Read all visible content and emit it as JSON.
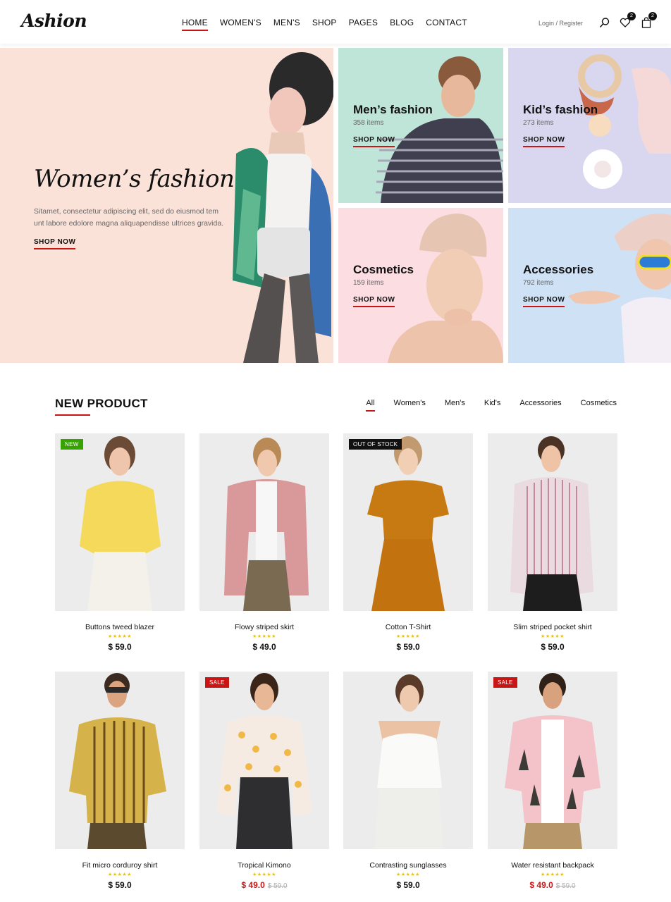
{
  "brand": {
    "logo": "Ashion"
  },
  "nav": {
    "items": [
      "HOME",
      "WOMEN'S",
      "MEN'S",
      "SHOP",
      "PAGES",
      "BLOG",
      "CONTACT"
    ],
    "active": "HOME"
  },
  "header": {
    "login": "Login / Register",
    "wishlist_count": "2",
    "cart_count": "2",
    "icons": [
      "search-icon",
      "heart-icon",
      "bag-icon"
    ]
  },
  "banner": {
    "women": {
      "title": "Women’s fashion",
      "description": "Sitamet, consectetur adipiscing elit, sed do eiusmod tem...id-unt labore edolore magna aliquapendisse ultrices gravida.",
      "desc_line1": "Sitamet, consectetur adipiscing elit, sed do eiusmod tem",
      "desc_line2": "unt labore edolore magna aliquapendisse ultrices gravida.",
      "cta": "SHOP NOW"
    },
    "categories": [
      {
        "title": "Men’s fashion",
        "count": "358 items",
        "cta": "SHOP NOW"
      },
      {
        "title": "Kid’s fashion",
        "count": "273 items",
        "cta": "SHOP NOW"
      },
      {
        "title": "Cosmetics",
        "count": "159 items",
        "cta": "SHOP NOW"
      },
      {
        "title": "Accessories",
        "count": "792 items",
        "cta": "SHOP NOW"
      }
    ]
  },
  "products_section": {
    "title": "NEW PRODUCT",
    "filters": [
      "All",
      "Women's",
      "Men's",
      "Kid's",
      "Accessories",
      "Cosmetics"
    ],
    "active_filter": "All",
    "rating_stars": "★★★★★",
    "products": [
      {
        "name": "Buttons tweed blazer",
        "price": "$ 59.0",
        "old_price": "",
        "label": "NEW",
        "rating": 5
      },
      {
        "name": "Flowy striped skirt",
        "price": "$ 49.0",
        "old_price": "",
        "label": "",
        "rating": 5
      },
      {
        "name": "Cotton T-Shirt",
        "price": "$ 59.0",
        "old_price": "",
        "label": "OUT OF STOCK",
        "rating": 5
      },
      {
        "name": "Slim striped pocket shirt",
        "price": "$ 59.0",
        "old_price": "",
        "label": "",
        "rating": 5
      },
      {
        "name": "Fit micro corduroy shirt",
        "price": "$ 59.0",
        "old_price": "",
        "label": "",
        "rating": 5
      },
      {
        "name": "Tropical Kimono",
        "price": "$ 49.0",
        "old_price": "$ 59.0",
        "label": "SALE",
        "rating": 5
      },
      {
        "name": "Contrasting sunglasses",
        "price": "$ 59.0",
        "old_price": "",
        "label": "",
        "rating": 5
      },
      {
        "name": "Water resistant backpack",
        "price": "$ 49.0",
        "old_price": "$ 59.0",
        "label": "SALE",
        "rating": 5
      }
    ]
  },
  "colors": {
    "accent": "#ca1515",
    "new_label": "#36a300",
    "out_of_stock_label": "#111111",
    "sale_label": "#ca1515",
    "star": "#e3c01c",
    "women_banner_bg": "#fbe2d8",
    "men_banner_bg": "#bfe4d8",
    "kids_banner_bg": "#d9d7ef",
    "cosmetics_banner_bg": "#fbdde2",
    "accessories_banner_bg": "#cfe2f5"
  }
}
